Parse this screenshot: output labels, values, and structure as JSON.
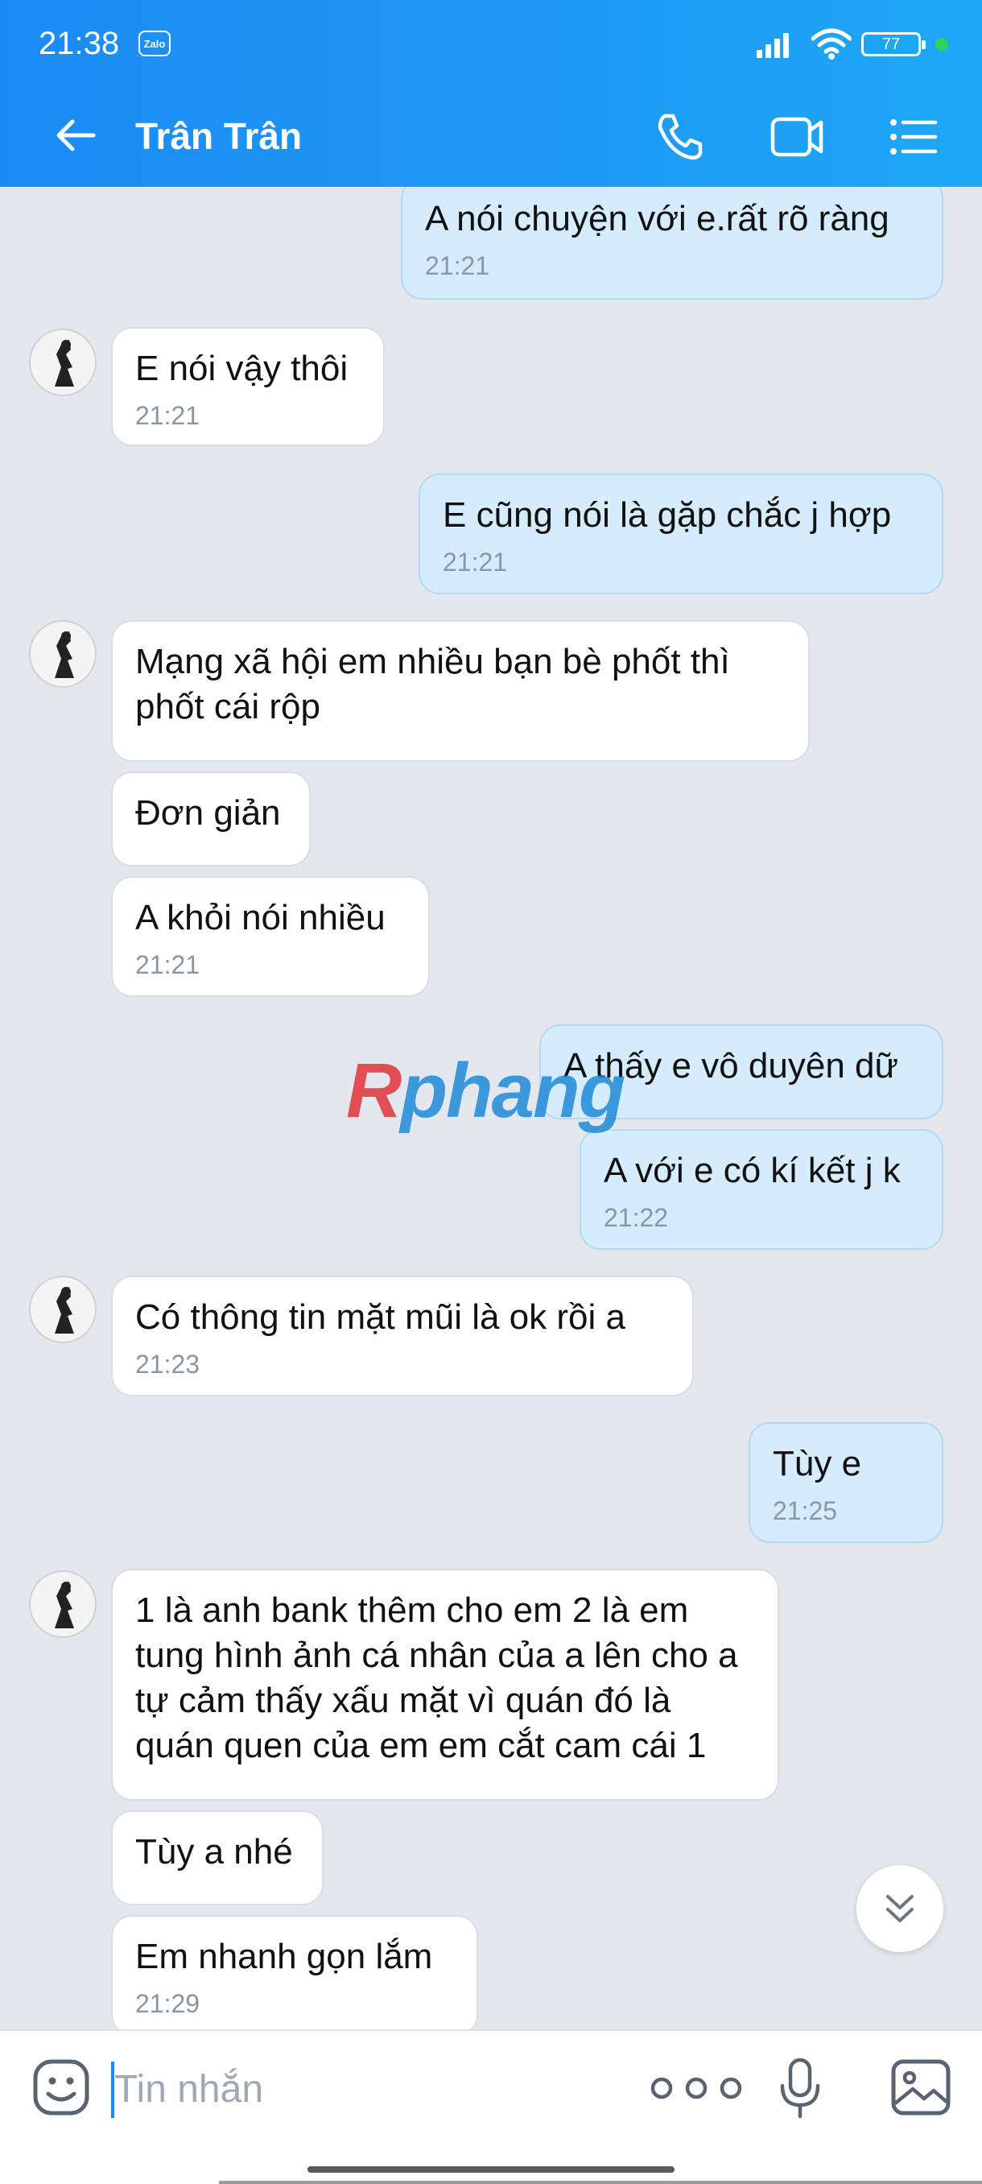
{
  "status_bar": {
    "time": "21:38",
    "app_icon": "Zalo",
    "battery": "77"
  },
  "header": {
    "title": "Trân Trân"
  },
  "messages": [
    {
      "side": "out",
      "text": "A nói chuyện với e.rất rõ ràng",
      "time": "21:21"
    },
    {
      "side": "in",
      "text": "E nói vậy thôi",
      "time": "21:21"
    },
    {
      "side": "out",
      "text": "E cũng nói là gặp chắc j hợp",
      "time": "21:21"
    },
    {
      "side": "in",
      "text": "Mạng xã hội em nhiều bạn bè phốt thì phốt cái rộp",
      "time": ""
    },
    {
      "side": "in",
      "text": "Đơn giản",
      "time": ""
    },
    {
      "side": "in",
      "text": "A khỏi nói nhiều",
      "time": "21:21"
    },
    {
      "side": "out",
      "text": "A thấy e vô duyên dữ",
      "time": ""
    },
    {
      "side": "out",
      "text": "A với e có kí kết j k",
      "time": "21:22"
    },
    {
      "side": "in",
      "text": "Có thông tin mặt mũi là ok rồi a",
      "time": "21:23"
    },
    {
      "side": "out",
      "text": "Tùy e",
      "time": "21:25"
    },
    {
      "side": "in",
      "text": "1 là anh bank thêm cho em 2 là em tung hình ảnh cá nhân của a lên cho a tự cảm thấy xấu mặt vì quán đó là quán quen của em em cắt cam cái 1",
      "time": ""
    },
    {
      "side": "in",
      "text": "Tùy a nhé",
      "time": ""
    },
    {
      "side": "in",
      "text": "Em nhanh gọn lắm",
      "time": "21:29"
    }
  ],
  "watermark": {
    "first": "R",
    "rest": "phang"
  },
  "input": {
    "placeholder": "Tin nhắn"
  },
  "colors": {
    "header": "#1b8bf4",
    "bubble_out": "#d5ecfc",
    "bubble_in": "#ffffff",
    "chat_bg": "#e3e8ef"
  }
}
